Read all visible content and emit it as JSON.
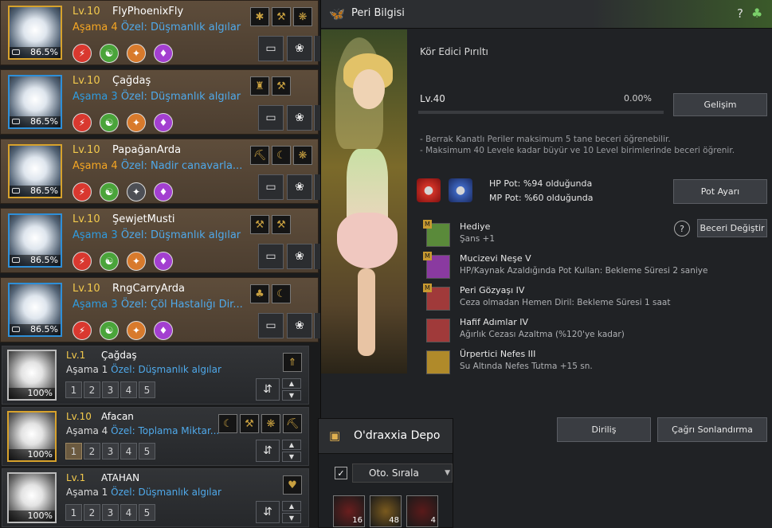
{
  "pets_active": [
    {
      "level": "Lv.10",
      "name": "FlyPhoenixFly",
      "stage": "Aşama 4",
      "stage_color": "orange",
      "special": "Özel: Düşmanlık algılar",
      "hunger": "86.5%",
      "frame": "gold",
      "skills": [
        "red",
        "grn",
        "org",
        "pur"
      ],
      "traits": [
        "ant-icon",
        "axe-icon",
        "wing-icon"
      ]
    },
    {
      "level": "Lv.10",
      "name": "Çağdaş",
      "stage": "Aşama 3",
      "stage_color": "blue",
      "special": "Özel: Düşmanlık algılar",
      "hunger": "86.5%",
      "frame": "blue",
      "skills": [
        "red",
        "grn",
        "org",
        "pur"
      ],
      "traits": [
        "person-icon",
        "axe-icon"
      ]
    },
    {
      "level": "Lv.10",
      "name": "PapağanArda",
      "stage": "Aşama 4",
      "stage_color": "orange",
      "special": "Özel: Nadir canavarla...",
      "hunger": "86.5%",
      "frame": "gold",
      "skills": [
        "red",
        "grn",
        "gry",
        "pur"
      ],
      "traits": [
        "pick-icon",
        "sickle-icon",
        "wing-icon"
      ]
    },
    {
      "level": "Lv.10",
      "name": "ŞewjetMusti",
      "stage": "Aşama 3",
      "stage_color": "blue",
      "special": "Özel: Düşmanlık algılar",
      "hunger": "86.5%",
      "frame": "blue",
      "skills": [
        "red",
        "grn",
        "org",
        "pur"
      ],
      "traits": [
        "hammer-icon",
        "axe-icon"
      ]
    },
    {
      "level": "Lv.10",
      "name": "RngCarryArda",
      "stage": "Aşama 3",
      "stage_color": "blue",
      "special": "Özel: Çöl Hastalığı Dir...",
      "hunger": "86.5%",
      "frame": "blue",
      "skills": [
        "red",
        "grn",
        "org",
        "pur"
      ],
      "traits": [
        "clover-icon",
        "sickle-icon"
      ]
    }
  ],
  "pets_stored": [
    {
      "level": "Lv.1",
      "name": "Çağdaş",
      "stage": "Aşama 1",
      "special": "Özel: Düşmanlık algılar",
      "hunger": "100%",
      "frame": "gray",
      "slots": [
        "1",
        "2",
        "3",
        "4",
        "5"
      ],
      "selected": 0,
      "traits": [
        "arrow-up-icon"
      ]
    },
    {
      "level": "Lv.10",
      "name": "Afacan",
      "stage": "Aşama 4",
      "special": "Özel: Toplama Miktar...",
      "hunger": "100%",
      "frame": "gold",
      "slots": [
        "1",
        "2",
        "3",
        "4",
        "5"
      ],
      "selected": 1,
      "traits": [
        "sickle-icon",
        "axe-icon",
        "wing-icon",
        "pick-icon"
      ]
    },
    {
      "level": "Lv.1",
      "name": "ATAHAN",
      "stage": "Aşama 1",
      "special": "Özel: Düşmanlık algılar",
      "hunger": "100%",
      "frame": "gray",
      "slots": [
        "1",
        "2",
        "3",
        "4",
        "5"
      ],
      "selected": 0,
      "traits": [
        "heart-icon"
      ]
    }
  ],
  "peri": {
    "title": "Peri Bilgisi",
    "subtitle": "Kör Edici Pırıltı",
    "level": "Lv.40",
    "exp": "0.00%",
    "exp_fraction": 0.0,
    "upgrade_btn": "Gelişim",
    "note1": "- Berrak Kanatlı Periler maksimum 5 tane beceri öğrenebilir.",
    "note2": "- Maksimum 40 Levele kadar büyür ve 10 Level birimlerinde beceri öğrenir.",
    "hp_pot": "HP Pot: %94 olduğunda",
    "mp_pot": "MP Pot: %60 olduğunda",
    "pot_btn": "Pot Ayarı",
    "skill_change_btn": "Beceri Değiştir",
    "skills": [
      {
        "title": "Hediye",
        "desc": "Şans +1",
        "icon": "clover-icon",
        "mark": "M"
      },
      {
        "title": "Mucizevi Neşe V",
        "desc": "HP/Kaynak Azaldığında Pot Kullan: Bekleme Süresi 2 saniye",
        "icon": "potion-icon",
        "mark": "M"
      },
      {
        "title": "Peri Gözyaşı IV",
        "desc": "Ceza olmadan Hemen Diril: Bekleme Süresi 1 saat",
        "icon": "tear-icon",
        "mark": "M"
      },
      {
        "title": "Hafif Adımlar IV",
        "desc": "Ağırlık Cezası Azaltma (%120'ye kadar)",
        "icon": "bag-icon",
        "mark": ""
      },
      {
        "title": "Ürpertici Nefes III",
        "desc": "Su Altında Nefes Tutma +15 sn.",
        "icon": "clock-icon",
        "mark": ""
      }
    ],
    "revive_btn": "Diriliş",
    "dismiss_btn": "Çağrı Sonlandırma"
  },
  "depot": {
    "title": "O'draxxia Depo",
    "autosort_label": "Oto. Sırala",
    "items": [
      {
        "count": "16",
        "color": "#6a1e1e"
      },
      {
        "count": "48",
        "color": "#7a5a1e"
      },
      {
        "count": "4",
        "color": "#5a1a1a"
      }
    ]
  }
}
